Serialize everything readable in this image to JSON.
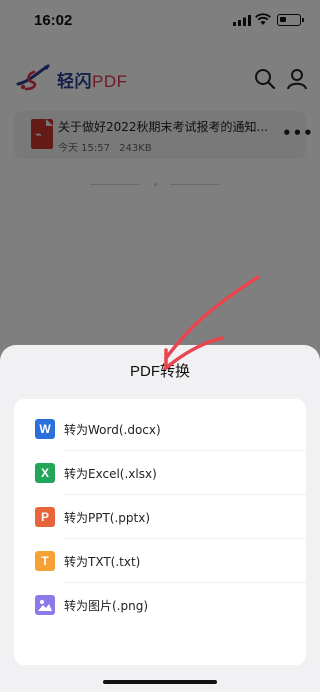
{
  "status_bar": {
    "time": "16:02"
  },
  "app_header": {
    "logo_name": "轻闪",
    "logo_suffix": "PDF",
    "search_icon": "search-icon",
    "user_icon": "user-icon"
  },
  "file": {
    "title": "关于做好2022秋期末考试报考的通知...",
    "date": "今天 15:57",
    "size": "243KB",
    "more_label": "•••"
  },
  "sheet": {
    "title": "PDF转换",
    "items": [
      {
        "icon_text": "W",
        "icon": "word-icon",
        "label": "转为Word(.docx)",
        "color": "#2b6fdc"
      },
      {
        "icon_text": "X",
        "icon": "excel-icon",
        "label": "转为Excel(.xlsx)",
        "color": "#23a55a"
      },
      {
        "icon_text": "P",
        "icon": "ppt-icon",
        "label": "转为PPT(.pptx)",
        "color": "#e8643a"
      },
      {
        "icon_text": "T",
        "icon": "txt-icon",
        "label": "转为TXT(.txt)",
        "color": "#f5a135"
      },
      {
        "icon_text": "",
        "icon": "image-icon",
        "label": "转为图片(.png)",
        "color": "#8b7be8"
      }
    ]
  },
  "colors": {
    "overlay": "rgba(0,0,0,0.5)",
    "annotation_arrow": "#e8454f",
    "brand_blue": "#2b3f8f",
    "brand_red": "#e0314b"
  }
}
